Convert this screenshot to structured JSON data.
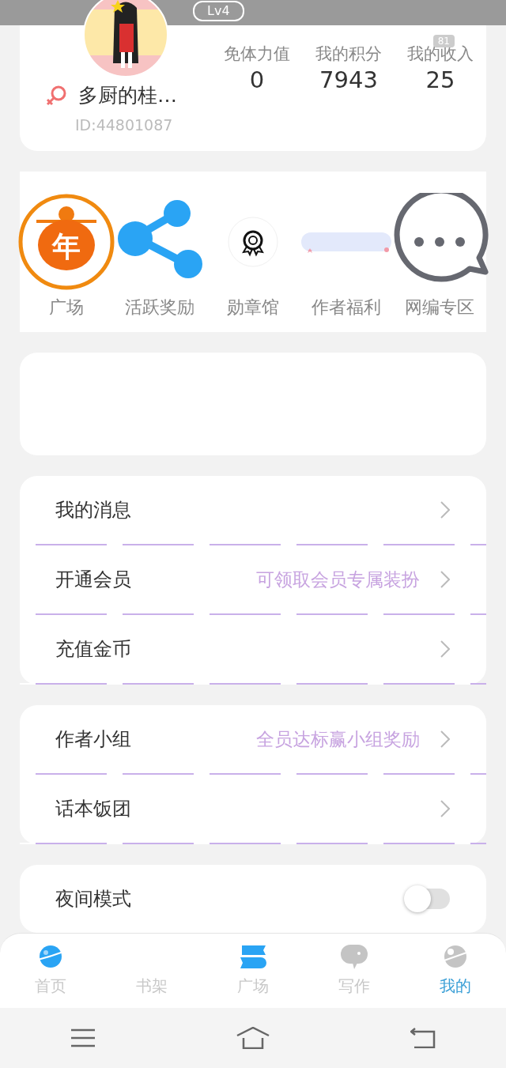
{
  "status_bar": {
    "battery": "81"
  },
  "profile": {
    "level": "Lv4",
    "name": "多厨的桂…",
    "id": "ID:44801087",
    "stats": [
      {
        "label": "免体力值",
        "value": "0"
      },
      {
        "label": "我的积分",
        "value": "7943"
      },
      {
        "label": "我的收入",
        "value": "25"
      }
    ]
  },
  "shortcuts": [
    {
      "kind": "ring",
      "badge": "年",
      "label": "广场"
    },
    {
      "kind": "share",
      "label": "活跃奖励"
    },
    {
      "kind": "medal",
      "label": "勋章馆"
    },
    {
      "kind": "banner",
      "label": "作者福利"
    },
    {
      "kind": "chat",
      "label": "网编专区"
    }
  ],
  "menu_groups": [
    [
      {
        "kind": "link",
        "label": "我的消息"
      },
      {
        "kind": "link",
        "label": "开通会员",
        "hint": "可领取会员专属装扮"
      },
      {
        "kind": "link",
        "label": "充值金币"
      }
    ],
    [
      {
        "kind": "link",
        "label": "作者小组",
        "hint": "全员达标赢小组奖励"
      },
      {
        "kind": "link",
        "label": "话本饭团"
      }
    ],
    [
      {
        "kind": "toggle",
        "label": "夜间模式",
        "on": false
      }
    ]
  ],
  "tabs": [
    {
      "kind": "planet",
      "label": "首页",
      "selected": false
    },
    {
      "kind": "none",
      "label": "书架",
      "selected": false
    },
    {
      "kind": "book",
      "label": "广场",
      "selected": false
    },
    {
      "kind": "bubble",
      "label": "写作",
      "selected": false
    },
    {
      "kind": "face",
      "label": "我的",
      "selected": true
    }
  ]
}
